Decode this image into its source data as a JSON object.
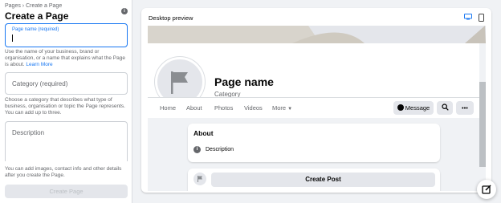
{
  "sidebar": {
    "breadcrumb": "Pages › Create a Page",
    "title": "Create a Page",
    "page_name_field": {
      "label": "Page name (required)",
      "value": ""
    },
    "page_name_help": "Use the name of your business, brand or organisation, or a name that explains what the Page is about.",
    "learn_more": "Learn More",
    "category_field": {
      "placeholder": "Category (required)"
    },
    "category_help": "Choose a category that describes what type of business, organisation or topic the Page represents. You can add up to three.",
    "description_field": {
      "placeholder": "Description"
    },
    "bottom_help": "You can add images, contact info and other details after you create the Page.",
    "create_button": "Create Page"
  },
  "preview": {
    "title": "Desktop preview",
    "page_name": "Page name",
    "category": "Category",
    "nav": [
      "Home",
      "About",
      "Photos",
      "Videos",
      "More"
    ],
    "message_button": "Message",
    "about": {
      "title": "About",
      "description": "Description"
    },
    "create_post": "Create Post"
  },
  "colors": {
    "accent": "#1877f2",
    "background": "#f0f2f5",
    "button_gray": "#e4e6eb"
  },
  "icons": [
    "info-icon",
    "desktop-icon",
    "mobile-icon",
    "flag-icon",
    "messenger-icon",
    "search-icon",
    "more-dots-icon",
    "edit-icon"
  ]
}
